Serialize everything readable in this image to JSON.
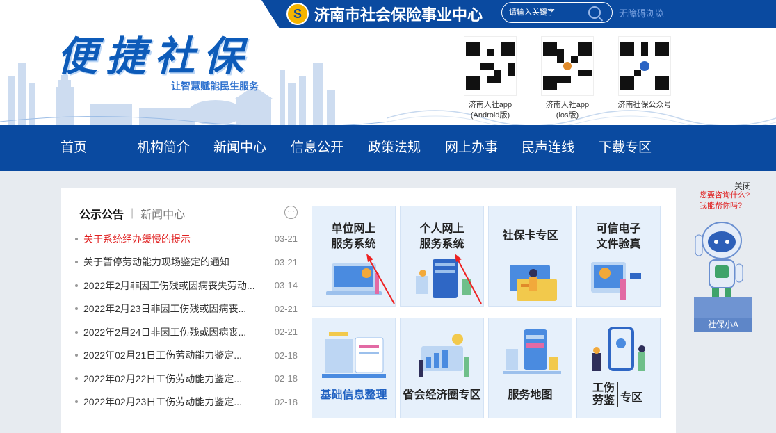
{
  "header": {
    "org_name": "济南市社会保险事业中心",
    "search_placeholder": "请输入关键字",
    "accessibility": "无障碍浏览",
    "brand_title": "便捷社保",
    "brand_slogan": "让智慧赋能民生服务",
    "qr_codes": [
      {
        "caption_line1": "济南人社app",
        "caption_line2": "(Android版)"
      },
      {
        "caption_line1": "济南人社app",
        "caption_line2": "(ios版)"
      },
      {
        "caption_line1": "济南社保公众号",
        "caption_line2": ""
      }
    ]
  },
  "nav": [
    "首页",
    "机构简介",
    "新闻中心",
    "信息公开",
    "政策法规",
    "网上办事",
    "民声连线",
    "下载专区"
  ],
  "notices": {
    "tab_active": "公示公告",
    "tab_other": "新闻中心",
    "more_label": "···",
    "items": [
      {
        "title": "关于系统经办缓慢的提示",
        "date": "03-21",
        "highlight": true
      },
      {
        "title": "关于暂停劳动能力现场鉴定的通知",
        "date": "03-21",
        "highlight": false
      },
      {
        "title": "2022年2月非因工伤残或因病丧失劳动...",
        "date": "03-14",
        "highlight": false
      },
      {
        "title": "2022年2月23日非因工伤残或因病丧...",
        "date": "02-21",
        "highlight": false
      },
      {
        "title": "2022年2月24日非因工伤残或因病丧...",
        "date": "02-21",
        "highlight": false
      },
      {
        "title": "2022年02月21日工伤劳动能力鉴定...",
        "date": "02-18",
        "highlight": false
      },
      {
        "title": "2022年02月22日工伤劳动能力鉴定...",
        "date": "02-18",
        "highlight": false
      },
      {
        "title": "2022年02月23日工伤劳动能力鉴定...",
        "date": "02-18",
        "highlight": false
      }
    ]
  },
  "services": {
    "unit": [
      "单位网上",
      "服务系统"
    ],
    "personal": [
      "个人网上",
      "服务系统"
    ],
    "card": "社保卡专区",
    "verify": [
      "可信电子",
      "文件验真"
    ],
    "basic_info": "基础信息整理",
    "economic": "省会经济圈专区",
    "map": "服务地图",
    "injury_a": "工伤",
    "injury_b": "劳鉴",
    "injury_c": "专区"
  },
  "assistant": {
    "close": "关闭",
    "ask_line1": "您要咨询什么?",
    "ask_line2": "我能帮你吗?",
    "name": "社保小A"
  },
  "colors": {
    "primary": "#0a4aa0",
    "accent_red": "#e02020",
    "tile_bg": "#e6f0fb"
  }
}
